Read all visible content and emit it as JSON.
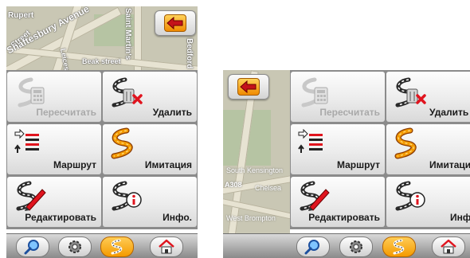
{
  "map": {
    "streets": [
      "Rupert",
      "Street",
      "Shaftesbury Avenue",
      "Saint Martin's",
      "Bedford",
      "Leicester",
      "Beak street"
    ],
    "places": [
      "South Kensington",
      "Chelsea",
      "West Brompton",
      "A308"
    ]
  },
  "menu": {
    "recalculate_label": "Пересчитать",
    "delete_label": "Удалить",
    "route_label": "Маршрут",
    "simulation_label": "Имитация",
    "edit_label": "Редактировать",
    "info_label": "Инфо."
  },
  "toolbar": {
    "buttons": [
      {
        "icon": "search-icon",
        "active": false
      },
      {
        "icon": "gear-icon",
        "active": false
      },
      {
        "icon": "route-icon",
        "active": true
      },
      {
        "icon": "home-icon",
        "active": false
      }
    ]
  },
  "colors": {
    "accent_orange": "#f49a00",
    "delete_red": "#e0141e",
    "map_background": "#c9c7b4"
  }
}
